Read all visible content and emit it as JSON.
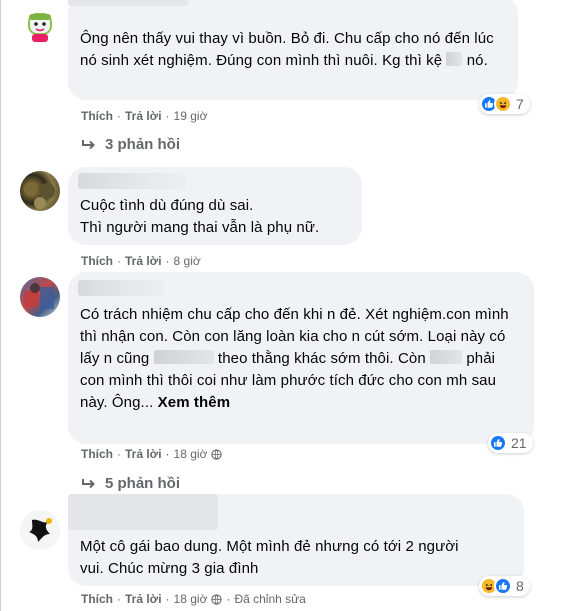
{
  "comments": [
    {
      "text_parts": [
        "Ông nên thấy vui thay vì buồn. Bỏ đi. Chu cấp cho nó đến lúc nó sinh xét nghiệm. Đúng con mình thì nuôi. Kg thì kệ ",
        " nó."
      ],
      "actions": {
        "like": "Thích",
        "reply": "Trả lời",
        "time": "19 giờ"
      },
      "reactions": {
        "icons": [
          "like-icon",
          "haha-icon"
        ],
        "count": "7"
      },
      "replies": "3 phản hồi"
    },
    {
      "lines": [
        "Cuộc tình dù đúng dù sai.",
        "Thì người mang thai vẫn là phụ nữ."
      ],
      "actions": {
        "like": "Thích",
        "reply": "Trả lời",
        "time": "8 giờ"
      }
    },
    {
      "text_parts": [
        "Có trách nhiệm chu cấp cho đến khi n đẻ. Xét nghiệm.con mình thì nhận con. Còn con lăng loàn kia cho n cút sớm. Loại này có lấy n cũng ",
        " theo thằng khác sớm thôi. Còn ",
        " phải con mình thì thôi coi như làm phước tích đức cho con mh sau này. Ông... "
      ],
      "see_more": "Xem thêm",
      "actions": {
        "like": "Thích",
        "reply": "Trả lời",
        "time": "18 giờ"
      },
      "reactions": {
        "icons": [
          "like-icon"
        ],
        "count": "21"
      },
      "replies": "5 phản hồi"
    },
    {
      "lines": [
        "Một cô gái bao dung. Một mình đẻ nhưng có tới 2 người",
        "vui. Chúc mừng 3 gia đình"
      ],
      "actions": {
        "like": "Thích",
        "reply": "Trả lời",
        "time": "18 giờ",
        "edited": "Đã chỉnh sửa"
      },
      "reactions": {
        "icons": [
          "haha-icon",
          "like-icon"
        ],
        "count": "8"
      }
    }
  ],
  "colors": {
    "like": "#1877f2",
    "haha": "#f7b928",
    "muted": "#65676b",
    "bubble": "#f0f2f5"
  }
}
